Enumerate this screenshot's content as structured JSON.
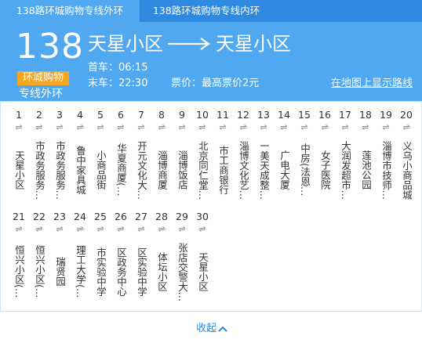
{
  "tabs": [
    {
      "label": "138路环城购物专线外环",
      "active": true
    },
    {
      "label": "138路环城购物专线内环",
      "active": false
    }
  ],
  "route": {
    "number": "138",
    "badge": "环城购物",
    "subtitle": "专线外环",
    "from": "天星小区",
    "to": "天星小区",
    "first_bus": "首车：06:15",
    "last_bus": "末车：22:30",
    "fare": "票价：最高票价2元",
    "map_link": "在地图上显示路线"
  },
  "stops": [
    {
      "idx": "1",
      "name": "天星小区"
    },
    {
      "idx": "2",
      "name": "市政务服务…"
    },
    {
      "idx": "3",
      "name": "市政务服务…"
    },
    {
      "idx": "4",
      "name": "鲁中家具城"
    },
    {
      "idx": "5",
      "name": "小商品街"
    },
    {
      "idx": "6",
      "name": "华夏商厦(…"
    },
    {
      "idx": "7",
      "name": "开元文化大…"
    },
    {
      "idx": "8",
      "name": "淄博商厦"
    },
    {
      "idx": "9",
      "name": "淄博饭店"
    },
    {
      "idx": "10",
      "name": "北京同仁堂…"
    },
    {
      "idx": "11",
      "name": "市工商银行"
    },
    {
      "idx": "12",
      "name": "淄博文化艺…"
    },
    {
      "idx": "13",
      "name": "一美天成整…"
    },
    {
      "idx": "14",
      "name": "广电大厦"
    },
    {
      "idx": "15",
      "name": "中房(法恩…"
    },
    {
      "idx": "16",
      "name": "女子医院"
    },
    {
      "idx": "17",
      "name": "大润发超市…"
    },
    {
      "idx": "18",
      "name": "莲池公园"
    },
    {
      "idx": "19",
      "name": "淄博市技师…"
    },
    {
      "idx": "20",
      "name": "义乌小商品城"
    },
    {
      "idx": "21",
      "name": "恒兴小区(…"
    },
    {
      "idx": "22",
      "name": "恒兴小区(…"
    },
    {
      "idx": "23",
      "name": "瑞贤园"
    },
    {
      "idx": "24",
      "name": "理工大学(…"
    },
    {
      "idx": "25",
      "name": "市实验中学"
    },
    {
      "idx": "26",
      "name": "区政务中心"
    },
    {
      "idx": "27",
      "name": "区实验中学"
    },
    {
      "idx": "28",
      "name": "体坛小区"
    },
    {
      "idx": "29",
      "name": "张店交警大…"
    },
    {
      "idx": "30",
      "name": "天星小区"
    }
  ],
  "swap_symbol": "⇌",
  "footer": {
    "collapse": "收起",
    "icon": "chevron-up-icon"
  },
  "colors": {
    "header_bg": "#4fa8f0",
    "tab_bar": "#2e8ae0",
    "badge": "#f5a623",
    "link": "#2e8ae0"
  }
}
